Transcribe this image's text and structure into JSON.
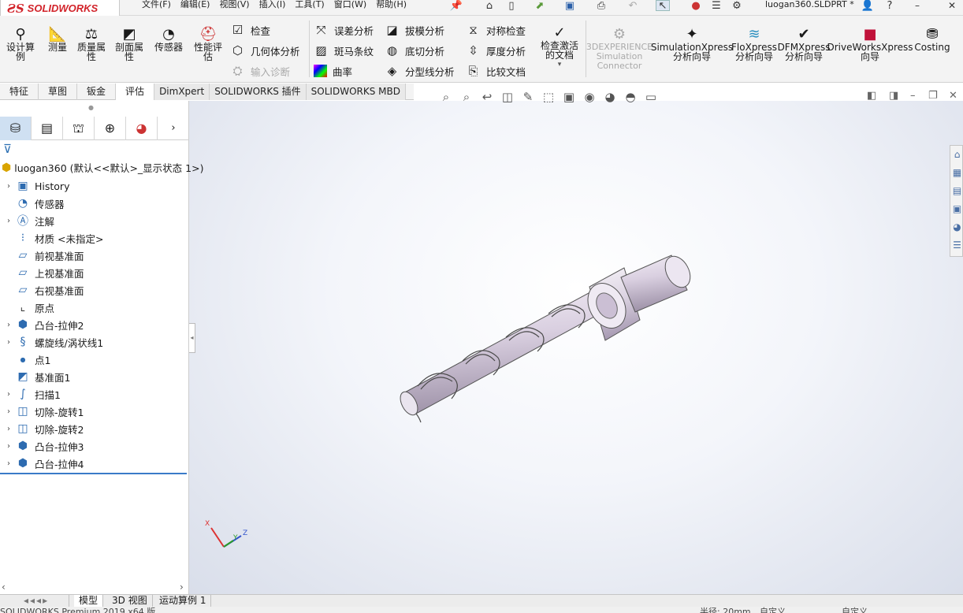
{
  "app": {
    "logo_ds": "ƧS",
    "logo_text": "SOLIDWORKS",
    "doc_title": "luogan360.SLDPRT *"
  },
  "menus": [
    "文件(F)",
    "编辑(E)",
    "视图(V)",
    "插入(I)",
    "工具(T)",
    "窗口(W)",
    "帮助(H)"
  ],
  "titlebar_icons": [
    "pin-icon",
    "home-icon",
    "new-document-icon",
    "open-icon",
    "save-icon",
    "print-icon",
    "undo-icon",
    "select-cursor-icon",
    "traffic-light-icon",
    "options-list-icon",
    "settings-gear-icon",
    "user-icon",
    "help-icon",
    "minimize-icon",
    "close-icon"
  ],
  "toolbar": {
    "large_buttons": [
      {
        "label": "设计算例",
        "icon": "design-study-icon"
      },
      {
        "label": "测量",
        "icon": "measure-icon"
      },
      {
        "label": "质量属性",
        "icon": "mass-properties-icon"
      },
      {
        "label": "剖面属性",
        "icon": "section-properties-icon"
      },
      {
        "label": "传感器",
        "icon": "sensor-icon"
      },
      {
        "label": "性能评估",
        "icon": "performance-evaluation-icon"
      }
    ],
    "col1": [
      {
        "label": "检查",
        "icon": "check-icon",
        "disabled": false
      },
      {
        "label": "几何体分析",
        "icon": "geometry-analysis-icon",
        "disabled": false
      },
      {
        "label": "输入诊断",
        "icon": "import-diagnostics-icon",
        "disabled": true
      }
    ],
    "col2": [
      {
        "label": "误差分析",
        "icon": "deviation-analysis-icon"
      },
      {
        "label": "斑马条纹",
        "icon": "zebra-stripes-icon"
      },
      {
        "label": "曲率",
        "icon": "curvature-icon"
      }
    ],
    "col3": [
      {
        "label": "拔模分析",
        "icon": "draft-analysis-icon"
      },
      {
        "label": "底切分析",
        "icon": "undercut-analysis-icon"
      },
      {
        "label": "分型线分析",
        "icon": "parting-line-analysis-icon"
      }
    ],
    "col4": [
      {
        "label": "对称检查",
        "icon": "symmetry-check-icon"
      },
      {
        "label": "厚度分析",
        "icon": "thickness-analysis-icon"
      },
      {
        "label": "比较文档",
        "icon": "compare-documents-icon"
      }
    ],
    "activate_docs": {
      "label": "检查激活的文档",
      "icon": "check-active-document-icon"
    },
    "addins": [
      {
        "label": "3DEXPERIENCE Simulation Connector",
        "icon": "3dexperience-icon",
        "disabled": true
      },
      {
        "label": "SimulationXpress 分析向导",
        "icon": "simulationxpress-icon",
        "disabled": false
      },
      {
        "label": "FloXpress 分析向导",
        "icon": "floxpress-icon",
        "disabled": false
      },
      {
        "label": "DFMXpress 分析向导",
        "icon": "dfmxpress-icon",
        "disabled": false
      },
      {
        "label": "DriveWorksXpress 向导",
        "icon": "driveworksxpress-icon",
        "disabled": false
      },
      {
        "label": "Costing",
        "icon": "costing-icon",
        "disabled": false
      }
    ]
  },
  "tabs": [
    {
      "label": "特征",
      "active": false
    },
    {
      "label": "草图",
      "active": false
    },
    {
      "label": "钣金",
      "active": false
    },
    {
      "label": "评估",
      "active": true
    },
    {
      "label": "DimXpert",
      "active": false
    },
    {
      "label": "SOLIDWORKS 插件",
      "active": false
    },
    {
      "label": "SOLIDWORKS MBD",
      "active": false
    }
  ],
  "feature_manager": {
    "panel_tabs": [
      "featuremanager-icon",
      "propertymanager-icon",
      "configurationmanager-icon",
      "dimxpert-manager-icon",
      "display-manager-icon"
    ],
    "root": "luogan360  (默认<<默认>_显示状态 1>)",
    "items": [
      {
        "label": "History",
        "icon": "history-folder-icon",
        "expandable": true
      },
      {
        "label": "传感器",
        "icon": "sensor-folder-icon",
        "expandable": false
      },
      {
        "label": "注解",
        "icon": "annotations-icon",
        "expandable": true
      },
      {
        "label": "材质 <未指定>",
        "icon": "material-icon",
        "expandable": false
      },
      {
        "label": "前视基准面",
        "icon": "plane-icon",
        "expandable": false
      },
      {
        "label": "上视基准面",
        "icon": "plane-icon",
        "expandable": false
      },
      {
        "label": "右视基准面",
        "icon": "plane-icon",
        "expandable": false
      },
      {
        "label": "原点",
        "icon": "origin-icon",
        "expandable": false
      },
      {
        "label": "凸台-拉伸2",
        "icon": "boss-extrude-icon",
        "expandable": true
      },
      {
        "label": "螺旋线/涡状线1",
        "icon": "helix-icon",
        "expandable": true
      },
      {
        "label": "点1",
        "icon": "point-icon",
        "expandable": false
      },
      {
        "label": "基准面1",
        "icon": "plane-feature-icon",
        "expandable": false
      },
      {
        "label": "扫描1",
        "icon": "sweep-icon",
        "expandable": true
      },
      {
        "label": "切除-旋转1",
        "icon": "cut-revolve-icon",
        "expandable": true
      },
      {
        "label": "切除-旋转2",
        "icon": "cut-revolve-icon",
        "expandable": true
      },
      {
        "label": "凸台-拉伸3",
        "icon": "boss-extrude-icon",
        "expandable": true
      },
      {
        "label": "凸台-拉伸4",
        "icon": "boss-extrude-icon",
        "expandable": true
      }
    ]
  },
  "bottom_tabs": [
    {
      "label": "模型",
      "active": true
    },
    {
      "label": "3D 视图",
      "active": false
    },
    {
      "label": "运动算例 1",
      "active": false
    }
  ],
  "status": {
    "left": "SOLIDWORKS Premium 2019 x64 版",
    "mid": "半径: 20mm",
    "right1": "自定义",
    "right2": "自定义"
  },
  "triad": {
    "x": "X",
    "y": "Y",
    "z": "Z"
  },
  "colors": {
    "brand_red": "#d2232a",
    "tree_accent": "#3b7bc8",
    "model_body": "#d8d0de"
  }
}
